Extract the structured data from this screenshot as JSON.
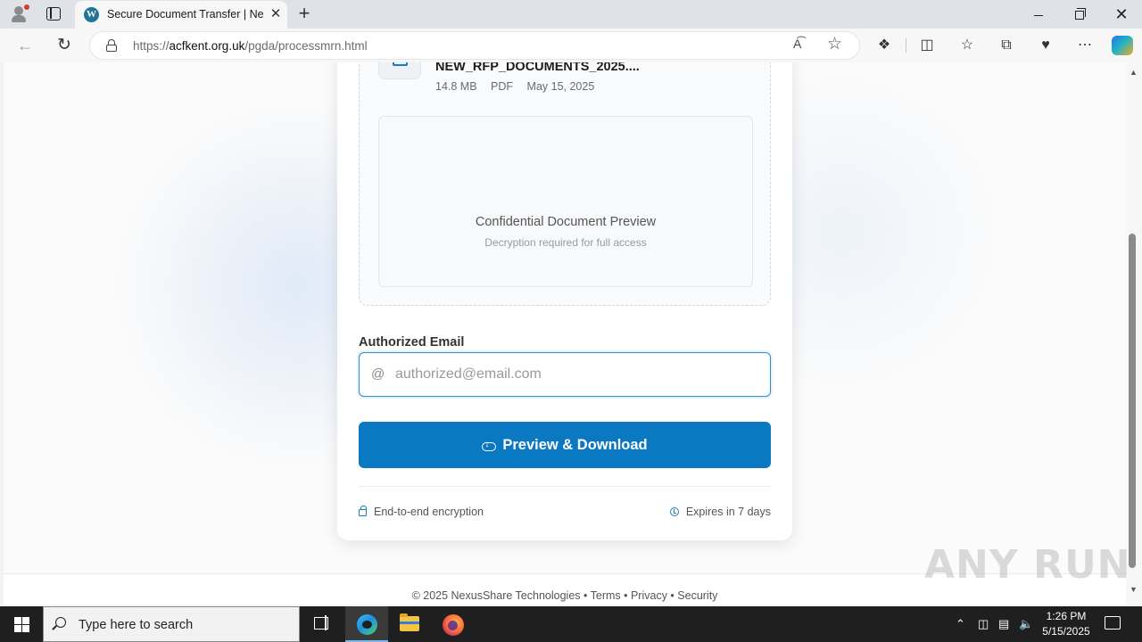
{
  "browser": {
    "tab_title": "Secure Document Transfer | Nexus",
    "tab_close": "✕",
    "new_tab": "+",
    "url_prefix": "https://",
    "url_host": "acfkent.org.uk",
    "url_path": "/pgda/processmrn.html",
    "read_aloud": "A͡",
    "window_close": "✕"
  },
  "document": {
    "name": "NEW_RFP_DOCUMENTS_2025....",
    "size": "14.8 MB",
    "type": "PDF",
    "date": "May 15, 2025",
    "preview_title": "Confidential Document Preview",
    "preview_subtitle": "Decryption required for full access"
  },
  "form": {
    "email_label": "Authorized Email",
    "email_prefix": "@",
    "email_placeholder": "authorized@email.com",
    "email_value": "",
    "submit_label": "Preview & Download"
  },
  "card_footer": {
    "encryption": "End-to-end encryption",
    "expiry": "Expires in 7 days"
  },
  "page_footer": "© 2025 NexusShare Technologies • Terms • Privacy • Security",
  "watermark": "ANY RUN",
  "taskbar": {
    "search_placeholder": "Type here to search",
    "time": "1:26 PM",
    "date": "5/15/2025"
  },
  "colors": {
    "accent": "#0b78c2",
    "input_border": "#2e8fd1",
    "icon_blue": "#1a7dc1"
  }
}
